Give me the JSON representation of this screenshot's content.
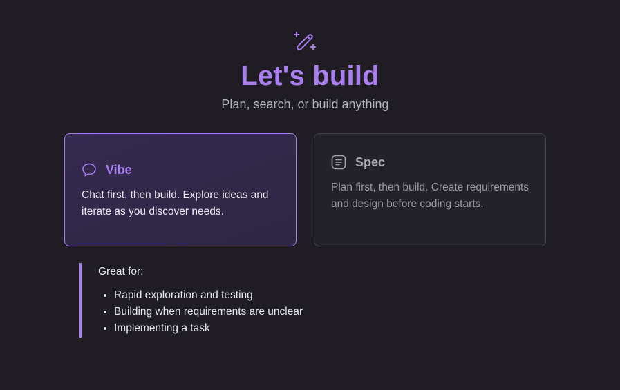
{
  "header": {
    "icon": "magic-wand-icon",
    "title": "Let's build",
    "subtitle": "Plan, search, or build anything"
  },
  "modes": [
    {
      "id": "vibe",
      "icon": "chat-bubble-icon",
      "title": "Vibe",
      "description": "Chat first, then build. Explore ideas and iterate as you discover needs.",
      "selected": true
    },
    {
      "id": "spec",
      "icon": "document-lines-icon",
      "title": "Spec",
      "description": "Plan first, then build. Create requirements and design before coding starts.",
      "selected": false
    }
  ],
  "great_for": {
    "heading": "Great for:",
    "items": [
      "Rapid exploration and testing",
      "Building when requirements are unclear",
      "Implementing a task"
    ]
  },
  "colors": {
    "background": "#1f1d23",
    "accent": "#a97ff0",
    "selected_card_bg": "#332848",
    "unselected_card_bg": "#242229"
  }
}
